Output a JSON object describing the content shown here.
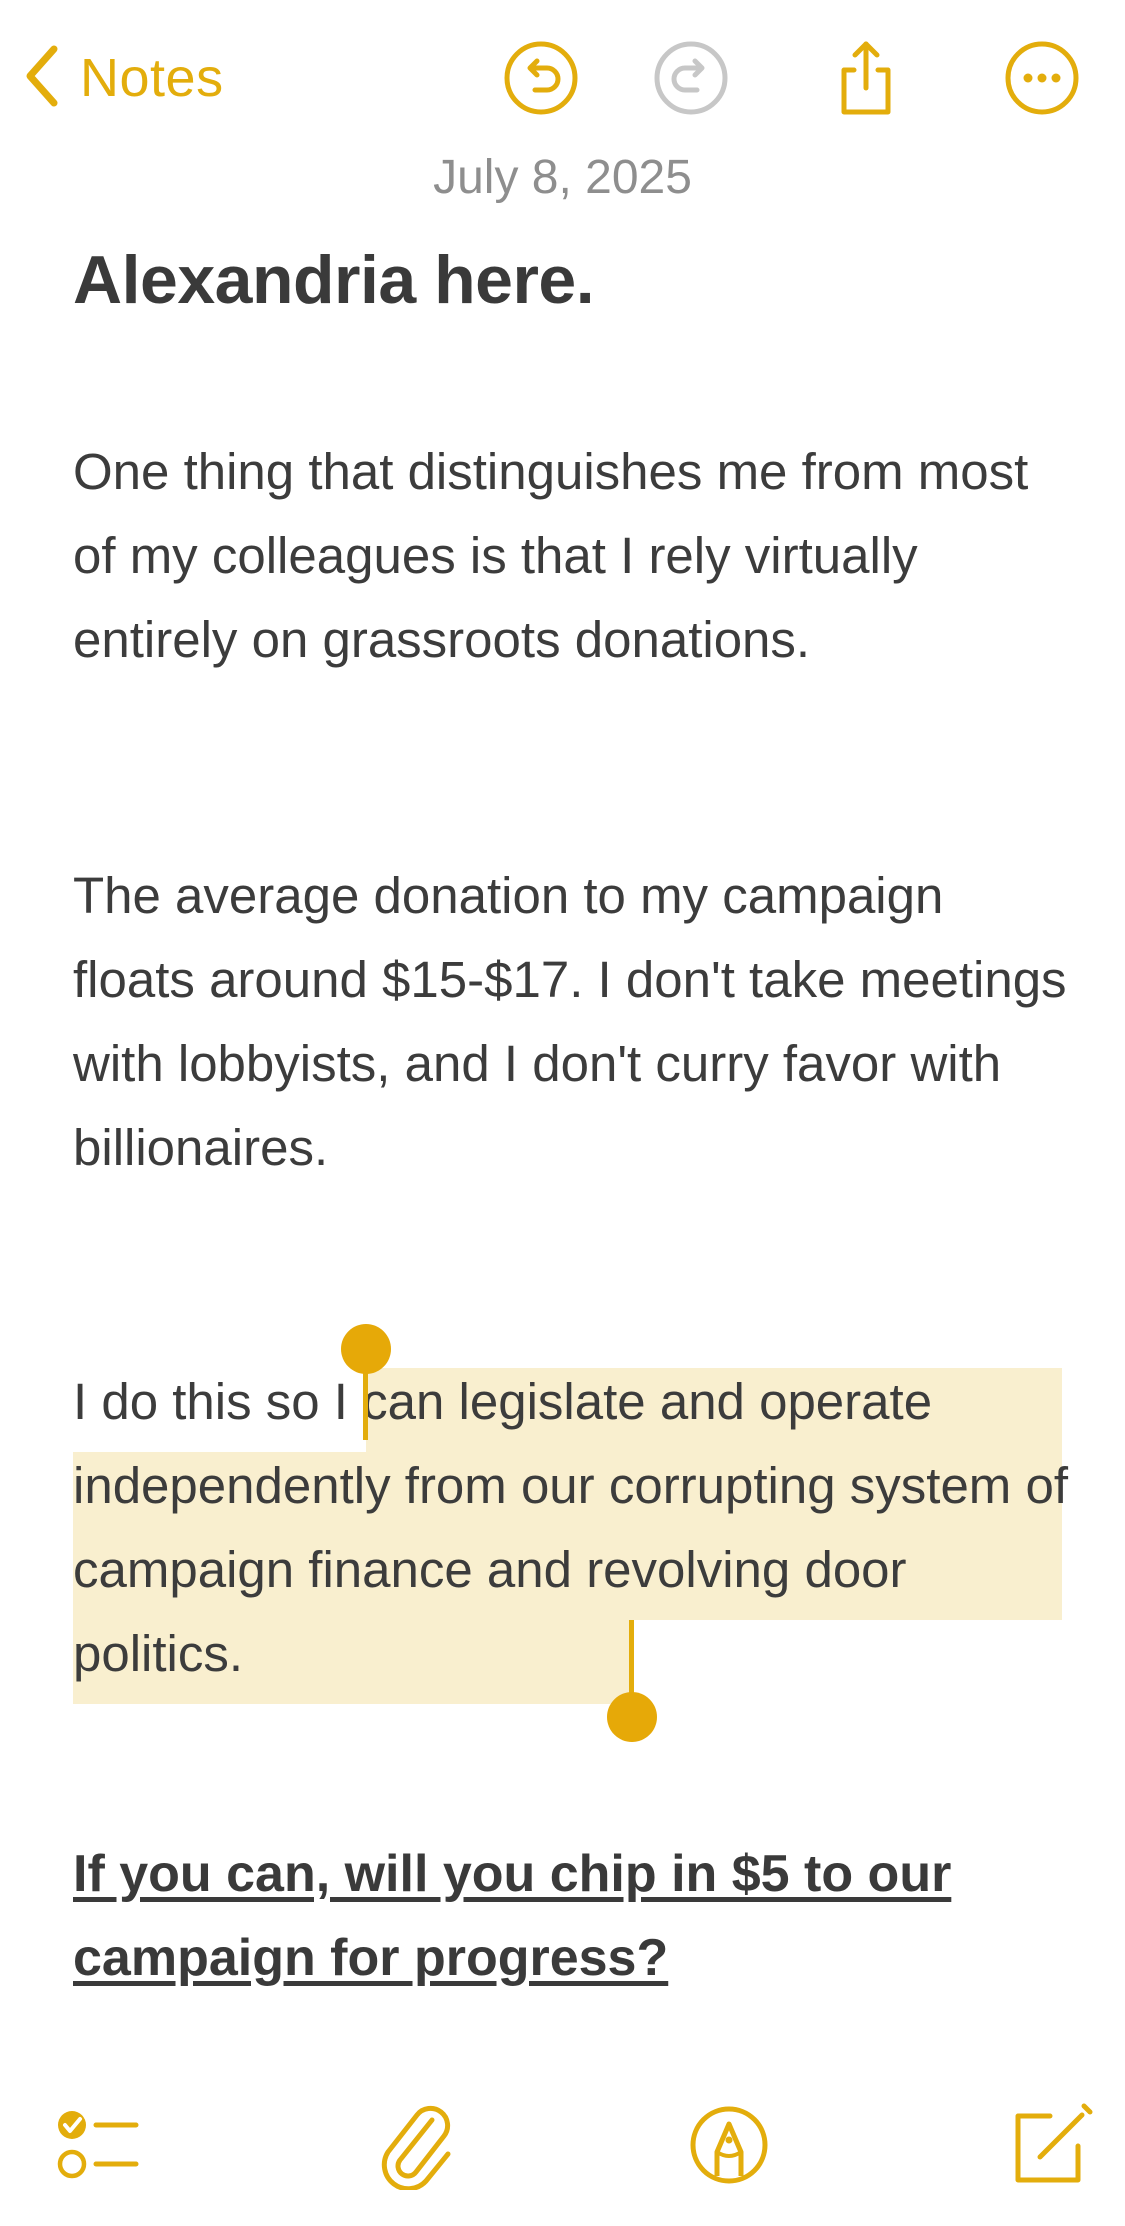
{
  "nav": {
    "back_label": "Notes",
    "icons": [
      "chevron-left-icon",
      "undo-icon",
      "redo-icon",
      "share-icon",
      "more-icon"
    ]
  },
  "note": {
    "date": "July 8, 2025",
    "title": "Alexandria here.",
    "paragraphs": [
      "One thing that distinguishes me from most of my colleagues is that I rely virtually entirely on grassroots donations.",
      "The average donation to my campaign floats around $15-$17. I don't take meetings with lobbyists, and I don't curry favor with billionaires.",
      "I do this so I can legislate and operate independently from our corrupting system of campaign finance and revolving door politics."
    ],
    "selected_text": "I can legislate and operate independently from our corrupting system of campaign finance and revolving door politics",
    "cta": "If you can, will you chip in $5 to our campaign for progress?"
  },
  "toolbar": {
    "icons": [
      "checklist-icon",
      "paperclip-icon",
      "markup-pen-icon",
      "compose-icon"
    ]
  },
  "colors": {
    "accent": "#e3ad0c",
    "selection": "#f9efcf",
    "text": "#3c3c3c",
    "date": "#8e8e8e",
    "disabled": "#c7c7c7"
  }
}
